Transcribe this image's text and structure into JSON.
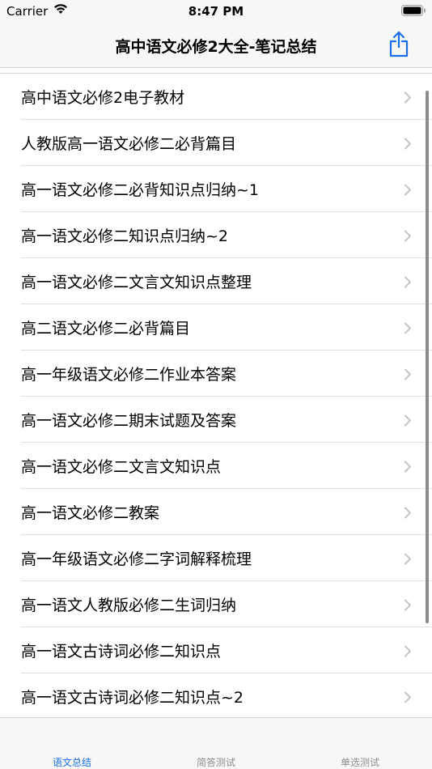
{
  "status_bar": {
    "carrier": "Carrier",
    "time": "8:47 PM"
  },
  "nav": {
    "title": "高中语文必修2大全-笔记总结",
    "share_icon": "share-icon",
    "accent_color": "#1a6fe8"
  },
  "list": {
    "items": [
      {
        "label": "高中语文必修2电子教材"
      },
      {
        "label": "人教版高一语文必修二必背篇目"
      },
      {
        "label": "高一语文必修二必背知识点归纳~1"
      },
      {
        "label": "高一语文必修二知识点归纳~2"
      },
      {
        "label": "高一语文必修二文言文知识点整理"
      },
      {
        "label": "高二语文必修二必背篇目"
      },
      {
        "label": "高一年级语文必修二作业本答案"
      },
      {
        "label": "高一语文必修二期末试题及答案"
      },
      {
        "label": "高一语文必修二文言文知识点"
      },
      {
        "label": "高一语文必修二教案"
      },
      {
        "label": "高一年级语文必修二字词解释梳理"
      },
      {
        "label": "高一语文人教版必修二生词归纳"
      },
      {
        "label": "高一语文古诗词必修二知识点"
      },
      {
        "label": "高一语文古诗词必修二知识点~2"
      }
    ]
  },
  "tab_bar": {
    "tabs": [
      {
        "label": "语文总结",
        "active": true
      },
      {
        "label": "简答测试",
        "active": false
      },
      {
        "label": "单选测试",
        "active": false
      }
    ]
  }
}
